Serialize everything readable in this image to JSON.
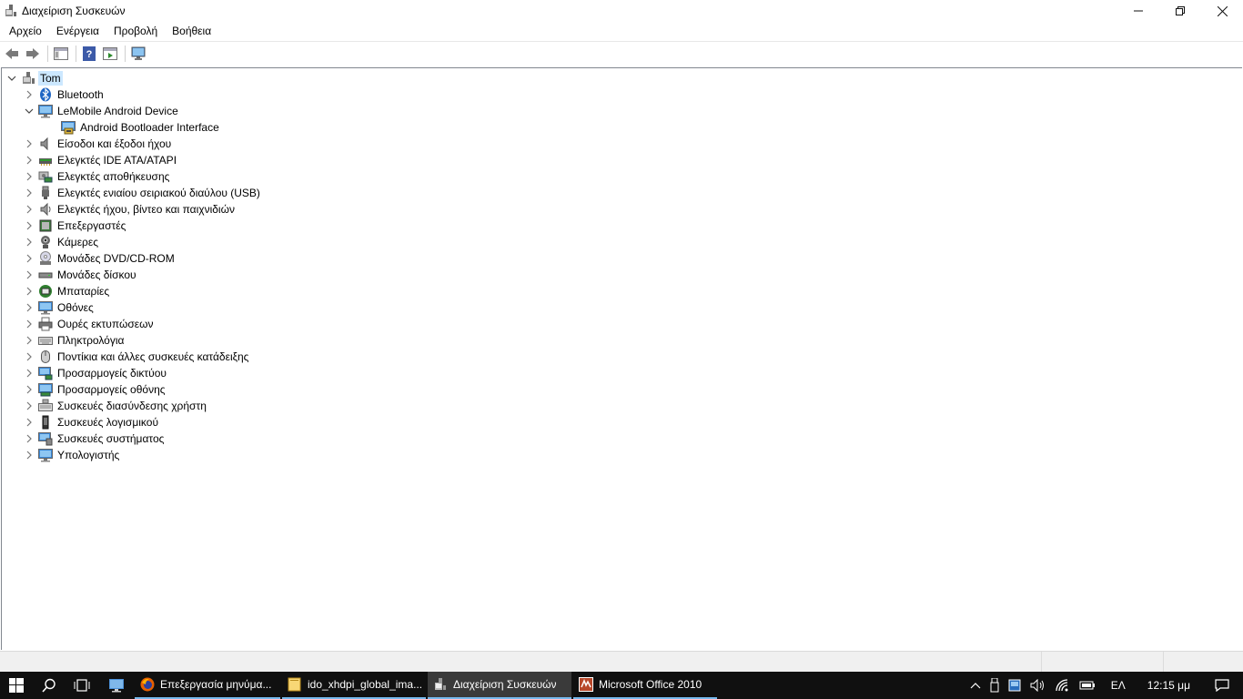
{
  "window": {
    "title": "Διαχείριση Συσκευών",
    "icon": "device-manager-icon",
    "controls": {
      "minimize": "—",
      "restore": "❐",
      "close": "✕"
    }
  },
  "menu": [
    "Αρχείο",
    "Ενέργεια",
    "Προβολή",
    "Βοήθεια"
  ],
  "toolbar": [
    {
      "icon": "back-arrow-icon"
    },
    {
      "icon": "forward-arrow-icon"
    },
    {
      "icon": "show-hide-console-tree-icon"
    },
    {
      "icon": "help-icon"
    },
    {
      "icon": "properties-icon"
    },
    {
      "icon": "scan-hardware-icon"
    }
  ],
  "tree": {
    "root": {
      "label": "Tom",
      "icon": "computer-root-icon",
      "expanded": true,
      "selected": true
    },
    "items": [
      {
        "label": "Bluetooth",
        "icon": "bluetooth-icon",
        "expanded": false,
        "level": 1
      },
      {
        "label": "LeMobile Android Device",
        "icon": "android-device-icon",
        "expanded": true,
        "level": 1
      },
      {
        "label": "Android Bootloader Interface",
        "icon": "android-interface-icon",
        "level": 2
      },
      {
        "label": "Είσοδοι και έξοδοι ήχου",
        "icon": "speaker-icon",
        "expanded": false,
        "level": 1
      },
      {
        "label": "Ελεγκτές IDE ATA/ATAPI",
        "icon": "ide-controller-icon",
        "expanded": false,
        "level": 1
      },
      {
        "label": "Ελεγκτές αποθήκευσης",
        "icon": "storage-controller-icon",
        "expanded": false,
        "level": 1
      },
      {
        "label": "Ελεγκτές ενιαίου σειριακού διαύλου (USB)",
        "icon": "usb-icon",
        "expanded": false,
        "level": 1
      },
      {
        "label": "Ελεγκτές ήχου, βίντεο και παιχνιδιών",
        "icon": "sound-video-icon",
        "expanded": false,
        "level": 1
      },
      {
        "label": "Επεξεργαστές",
        "icon": "processor-icon",
        "expanded": false,
        "level": 1
      },
      {
        "label": "Κάμερες",
        "icon": "camera-icon",
        "expanded": false,
        "level": 1
      },
      {
        "label": "Μονάδες DVD/CD-ROM",
        "icon": "dvd-drive-icon",
        "expanded": false,
        "level": 1
      },
      {
        "label": "Μονάδες δίσκου",
        "icon": "disk-drive-icon",
        "expanded": false,
        "level": 1
      },
      {
        "label": "Μπαταρίες",
        "icon": "battery-icon",
        "expanded": false,
        "level": 1
      },
      {
        "label": "Οθόνες",
        "icon": "monitor-icon",
        "expanded": false,
        "level": 1
      },
      {
        "label": "Ουρές εκτυπώσεων",
        "icon": "printer-icon",
        "expanded": false,
        "level": 1
      },
      {
        "label": "Πληκτρολόγια",
        "icon": "keyboard-icon",
        "expanded": false,
        "level": 1
      },
      {
        "label": "Ποντίκια και άλλες συσκευές κατάδειξης",
        "icon": "mouse-icon",
        "expanded": false,
        "level": 1
      },
      {
        "label": "Προσαρμογείς δικτύου",
        "icon": "network-adapter-icon",
        "expanded": false,
        "level": 1
      },
      {
        "label": "Προσαρμογείς οθόνης",
        "icon": "display-adapter-icon",
        "expanded": false,
        "level": 1
      },
      {
        "label": "Συσκευές διασύνδεσης χρήστη",
        "icon": "hid-icon",
        "expanded": false,
        "level": 1
      },
      {
        "label": "Συσκευές λογισμικού",
        "icon": "software-device-icon",
        "expanded": false,
        "level": 1
      },
      {
        "label": "Συσκευές συστήματος",
        "icon": "system-device-icon",
        "expanded": false,
        "level": 1
      },
      {
        "label": "Υπολογιστής",
        "icon": "computer-icon",
        "expanded": false,
        "level": 1
      }
    ]
  },
  "taskbar": {
    "tasks": [
      {
        "label": "Επεξεργασία μηνύμα...",
        "icon": "firefox-icon",
        "active": false
      },
      {
        "label": "ido_xhdpi_global_ima...",
        "icon": "folder-icon",
        "active": false
      },
      {
        "label": "Διαχείριση Συσκευών",
        "icon": "device-manager-icon",
        "active": true
      },
      {
        "label": "Microsoft Office 2010",
        "icon": "office-icon",
        "active": false
      }
    ],
    "tray": {
      "language": "ΕΛ",
      "time": "12:15 μμ"
    }
  },
  "colors": {
    "selection": "#cce8ff",
    "taskbar_bg": "#101010",
    "task_underline": "#76b9ed"
  }
}
